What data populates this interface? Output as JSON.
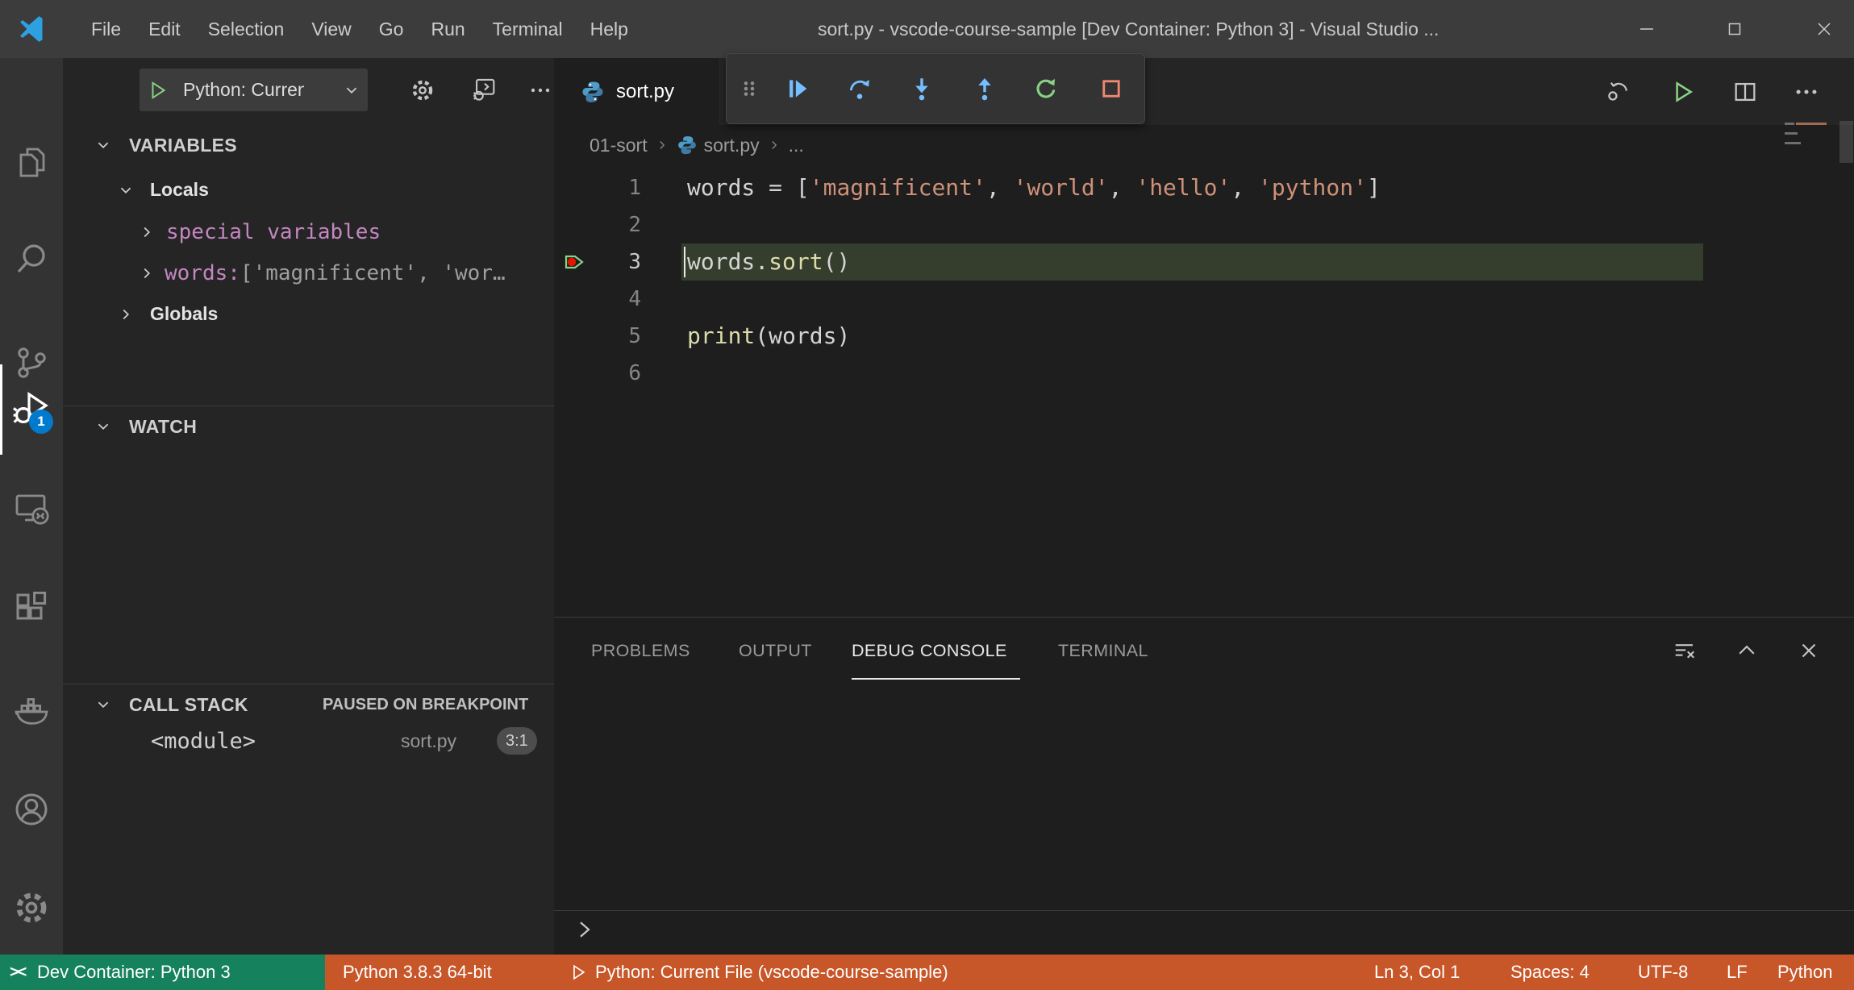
{
  "titlebar": {
    "menus": [
      "File",
      "Edit",
      "Selection",
      "View",
      "Go",
      "Run",
      "Terminal",
      "Help"
    ],
    "title": "sort.py - vscode-course-sample [Dev Container: Python 3] - Visual Studio ..."
  },
  "activity_bar": {
    "items": [
      "explorer",
      "search",
      "source-control",
      "run-and-debug",
      "remote-explorer",
      "extensions",
      "docker",
      "accounts",
      "settings"
    ],
    "active": "run-and-debug",
    "badge": "1"
  },
  "sidebar": {
    "launch": {
      "label": "Python: Current"
    },
    "variables": {
      "header": "VARIABLES",
      "locals": "Locals",
      "globals": "Globals",
      "items": [
        {
          "name": "special variables",
          "value": ""
        },
        {
          "name": "words: ",
          "value": "['magnificent', 'wor…"
        }
      ]
    },
    "watch": {
      "header": "WATCH"
    },
    "call_stack": {
      "header": "CALL STACK",
      "status": "PAUSED ON BREAKPOINT",
      "frames": [
        {
          "name": "<module>",
          "file": "sort.py",
          "position": "3:1"
        }
      ]
    }
  },
  "editor": {
    "tab": {
      "label": "sort.py"
    },
    "breadcrumbs": [
      "01-sort",
      "sort.py",
      "..."
    ],
    "line_numbers": [
      "1",
      "2",
      "3",
      "4",
      "5",
      "6"
    ],
    "code": {
      "l1": [
        "words",
        " = [",
        "'magnificent'",
        ", ",
        "'world'",
        ", ",
        "'hello'",
        ", ",
        "'python'",
        "]"
      ],
      "l3": [
        "words",
        ".",
        "sort",
        "()"
      ],
      "l5": [
        "print",
        "(",
        "words",
        ")"
      ]
    },
    "debug_toolbar": [
      "continue",
      "step-over",
      "step-into",
      "step-out",
      "restart",
      "stop"
    ]
  },
  "panel": {
    "tabs": [
      "PROBLEMS",
      "OUTPUT",
      "DEBUG CONSOLE",
      "TERMINAL"
    ],
    "active_tab": "DEBUG CONSOLE"
  },
  "status_bar": {
    "remote": "Dev Container: Python 3",
    "interpreter": "Python 3.8.3 64-bit",
    "launch": "Python: Current File (vscode-course-sample)",
    "cursor": "Ln 3, Col 1",
    "indent": "Spaces: 4",
    "encoding": "UTF-8",
    "eol": "LF",
    "language": "Python"
  },
  "colors": {
    "status_debug_bg": "#C75629",
    "remote_green": "#16825D",
    "badge_blue": "#007ACC",
    "string": "#CE9178",
    "function": "#DCDCAA",
    "variable_pink": "#C586C0",
    "debug_blue": "#75beff",
    "debug_green": "#89d185",
    "debug_red": "#F48771",
    "breakpoint_red": "#E51400"
  }
}
